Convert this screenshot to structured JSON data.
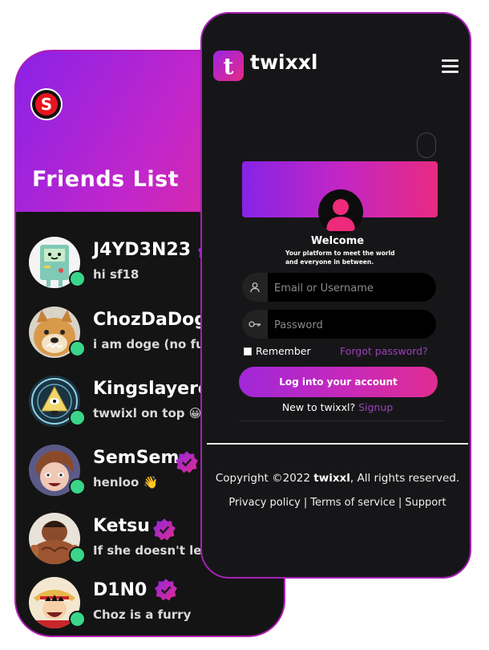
{
  "friends_screen": {
    "title": "Friends List",
    "friends": [
      {
        "name": "J4YD3N23",
        "status": "hi sf18"
      },
      {
        "name": "ChozDaDog",
        "status": "i am doge (no fur"
      },
      {
        "name": "Kingslayere",
        "status": "twwixl on top 😀"
      },
      {
        "name": "SemSem",
        "status": "henloo 👋"
      },
      {
        "name": "Ketsu",
        "status": "If she doesn't let y"
      },
      {
        "name": "D1N0",
        "status": "Choz is a furry"
      }
    ],
    "online_color": "#39d68a",
    "accent_color": "#b31fb5"
  },
  "login_screen": {
    "brand": "twixxl",
    "logo_letter": "t",
    "welcome": "Welcome",
    "tagline": "Your platform to meet the world and everyone in between.",
    "username_placeholder": "Email or Username",
    "password_placeholder": "Password",
    "remember_label": "Remember",
    "forgot_label": "Forgot password?",
    "login_button": "Log into your account",
    "new_prompt": "New to twixxl?",
    "signup_label": "Signup",
    "copyright_prefix": "Copyright ©2022",
    "copyright_brand": "twixxl",
    "copyright_suffix": ", All rights reserved.",
    "footer_links": [
      "Privacy policy",
      "Terms of service",
      "Support"
    ],
    "link_color": "#9b41b8",
    "gradient_start": "#8a22e8",
    "gradient_end": "#e82a82"
  }
}
